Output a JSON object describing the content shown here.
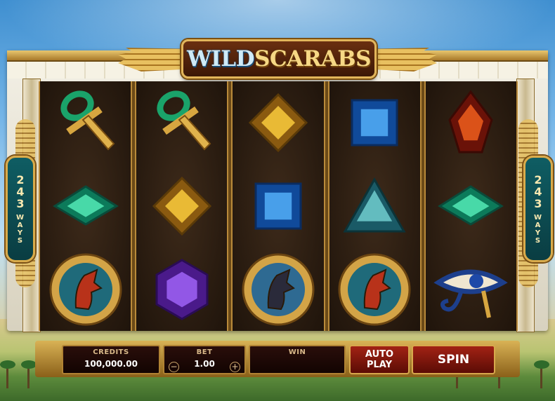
{
  "game": {
    "title_part1": "WILD",
    "title_part2": "SCARABS",
    "ways_left": {
      "number": "243",
      "label": "WAYS"
    },
    "ways_right": {
      "number": "243",
      "label": "WAYS"
    }
  },
  "reels": [
    [
      "ankh-icon",
      "green-gem-icon",
      "horus-medallion-icon"
    ],
    [
      "ankh-icon",
      "yellow-gem-icon",
      "purple-gem-icon"
    ],
    [
      "yellow-gem-icon",
      "blue-gem-icon",
      "anubis-medallion-icon"
    ],
    [
      "blue-gem-icon",
      "teal-pyramid-gem-icon",
      "horus-medallion-icon"
    ],
    [
      "red-gem-icon",
      "green-gem-icon",
      "eye-of-horus-icon"
    ]
  ],
  "controls": {
    "credits_label": "CREDITS",
    "credits_value": "100,000.00",
    "bet_label": "BET",
    "bet_value": "1.00",
    "bet_minus": "−",
    "bet_plus": "+",
    "win_label": "WIN",
    "win_value": "",
    "autoplay_line1": "AUTO",
    "autoplay_line2": "PLAY",
    "spin_label": "SPIN"
  },
  "colors": {
    "accent_gold": "#d9b255",
    "button_red": "#a22214",
    "panel_teal": "#0f5d63"
  }
}
